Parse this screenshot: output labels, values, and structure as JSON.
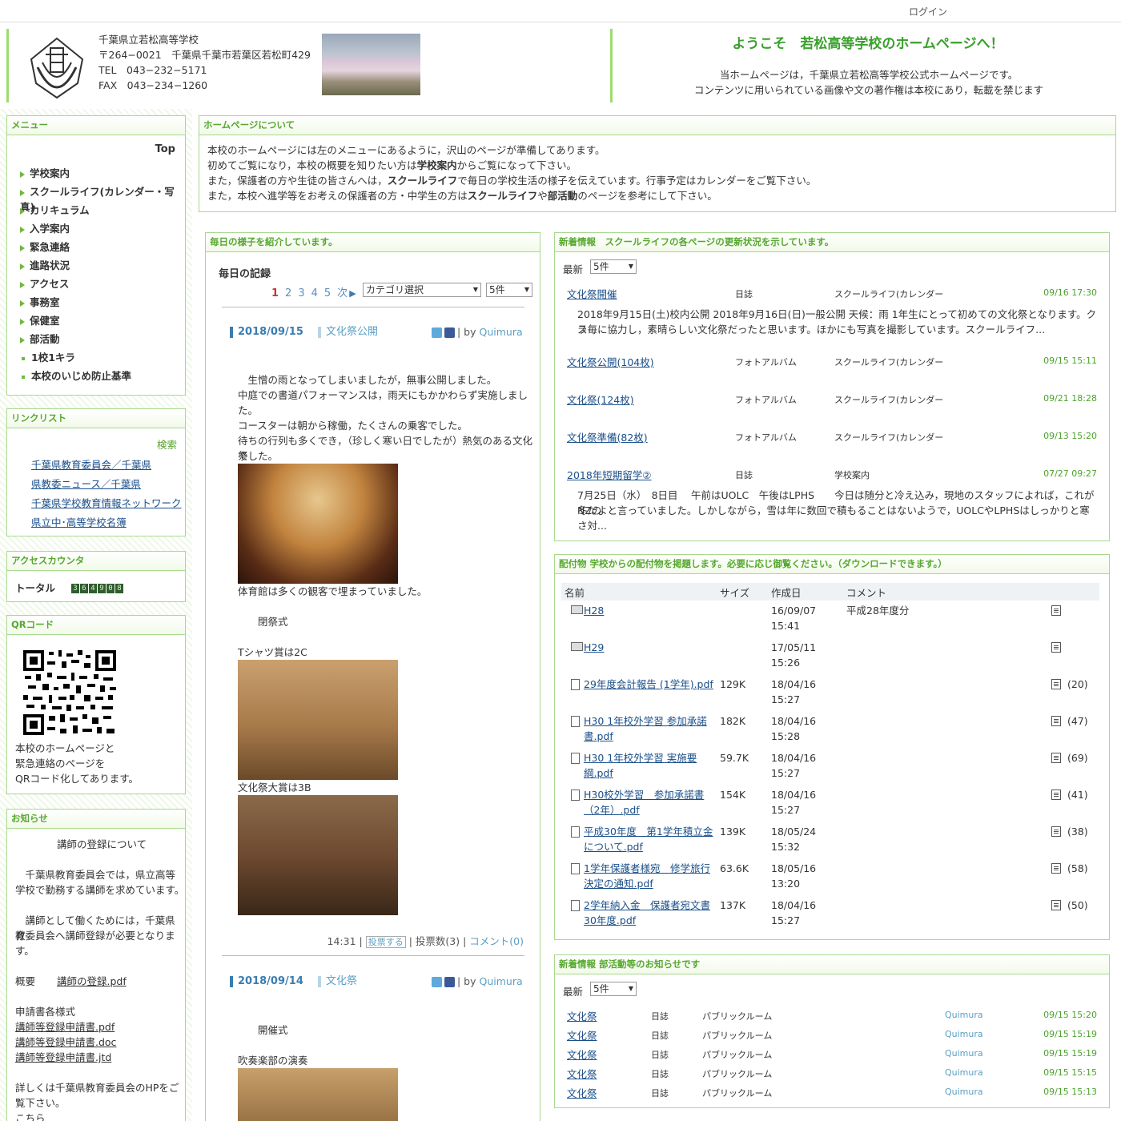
{
  "topbar": {
    "login": "ログイン"
  },
  "header": {
    "school_name": "千葉県立若松高等学校",
    "address": "〒264−0021　千葉県千葉市若葉区若松町429",
    "tel": "TEL　043−232−5171",
    "fax": "FAX　043−234−1260",
    "welcome": "ようこそ　若松高等学校のホームページへ！",
    "welcome_sub1": "当ホームページは，千葉県立若松高等学校公式ホームページです。",
    "welcome_sub2": "コンテンツに用いられている画像や文の著作権は本校にあり，転載を禁じます"
  },
  "menu": {
    "title": "メニュー",
    "top": "Top",
    "items": [
      "学校案内",
      "スクールライフ(カレンダー・写真)",
      "カリキュラム",
      "入学案内",
      "緊急連絡",
      "進路状況",
      "アクセス",
      "事務室",
      "保健室",
      "部活動"
    ],
    "dot_items": [
      "1校1キラ",
      "本校のいじめ防止基準"
    ]
  },
  "links": {
    "title": "リンクリスト",
    "search": "検索",
    "items": [
      "千葉県教育委員会／千葉県",
      "県教委ニュース／千葉県",
      "千葉県学校教育情報ネットワーク",
      "県立中･高等学校名簿"
    ]
  },
  "counter": {
    "title": "アクセスカウンタ",
    "label": "トータル",
    "digits": [
      "3",
      "6",
      "4",
      "9",
      "0",
      "8"
    ]
  },
  "qr": {
    "title": "QRコード",
    "lines": [
      "本校のホームページと",
      "緊急連絡のページを",
      "QRコード化してあります。"
    ]
  },
  "notice": {
    "title": "お知らせ",
    "heading": "講師の登録について",
    "p1a": "　千葉県教育委員会では，県立高等",
    "p1b": "学校で勤務する講師を求めています。",
    "p2a": "　講師として働くためには，千葉県教",
    "p2b": "育委員会へ講師登録が必要となりま",
    "p2c": "す。",
    "summary_label": "概要",
    "summary_link": "講師の登録.pdf",
    "forms_label": "申請書各様式",
    "forms": [
      "講師等登録申請書.pdf",
      "講師等登録申請書.doc",
      "講師等登録申請書.jtd"
    ],
    "detail1": "詳しくは千葉県教育委員会のHPをご",
    "detail2": "覧下さい。",
    "detail_link": "こちら"
  },
  "about": {
    "title": "ホームページについて",
    "l1": "本校のホームページには左のメニューにあるように，沢山のページが準備してあります。",
    "l2a": "初めてご覧になり，本校の概要を知りたい方は",
    "l2b": "学校案内",
    "l2c": "からご覧になって下さい。",
    "l3a": "また，保護者の方や生徒の皆さんへは，",
    "l3b": "スクールライフ",
    "l3c": "で毎日の学校生活の様子を伝えています。行事予定はカレンダーをご覧下さい。",
    "l4a": "また，本校へ進学等をお考えの保護者の方・中学生の方は",
    "l4b": "スクールライフ",
    "l4c": "や",
    "l4d": "部活動",
    "l4e": "のページを参考にして下さい。"
  },
  "diary": {
    "title": "毎日の様子を紹介しています。",
    "heading": "毎日の記録",
    "pages": [
      "1",
      "2",
      "3",
      "4",
      "5"
    ],
    "next": "次",
    "category": "カテゴリ選択",
    "count": "5件",
    "post1": {
      "date": "2018/09/15",
      "cat": "文化祭公開",
      "by": "| by",
      "author": "Quimura",
      "lines": [
        "　生憎の雨となってしまいましたが，無事公開しました。",
        "中庭での書道パフォーマンスは，雨天にもかかわらず実施しまし",
        "た。",
        "コースターは朝から稼働，たくさんの乗客でした。",
        "待ちの行列も多くでき，（珍しく寒い日でしたが）熱気のある文化祭",
        "でした。"
      ],
      "cap1": "体育館は多くの観客で埋まっていました。",
      "cap2": "　　閉祭式",
      "cap3": "Tシャツ賞は2C",
      "cap4": "文化祭大賞は3B",
      "time": "14:31 |",
      "vote": "投票する",
      "votes": "| 投票数(3) |",
      "comments": "コメント(0)"
    },
    "post2": {
      "date": "2018/09/14",
      "cat": "文化祭",
      "by": "| by",
      "author": "Quimura",
      "l1": "　　開催式",
      "l2": "吹奏楽部の演奏"
    }
  },
  "news": {
    "title": "新着情報　スクールライフの各ページの更新状況を示しています。",
    "latest": "最新",
    "count": "5件",
    "rows": [
      {
        "t": "文化祭開催",
        "type": "日誌",
        "area": "スクールライフ(カレンダー",
        "date": "09/16 17:30",
        "body": [
          "2018年9月15日(土)校内公開 2018年9月16日(日)一般公開 天候：雨 1年生にとって初めての文化祭となります。クラ",
          "ス毎に協力し，素晴らしい文化祭だったと思います。ほかにも写真を撮影しています。スクールライフ..."
        ]
      },
      {
        "t": "文化祭公開(104枚)",
        "type": "フォトアルバム",
        "area": "スクールライフ(カレンダー",
        "date": "09/15 15:11"
      },
      {
        "t": "文化祭(124枚)",
        "type": "フォトアルバム",
        "area": "スクールライフ(カレンダー",
        "date": "09/21 18:28"
      },
      {
        "t": "文化祭準備(82枚)",
        "type": "フォトアルバム",
        "area": "スクールライフ(カレンダー",
        "date": "09/13 15:20"
      },
      {
        "t": "2018年短期留学②",
        "type": "日誌",
        "area": "学校案内",
        "date": "07/27 09:27",
        "body": [
          "7月25日（水）　8日目　 午前はUOLC　午後はLPHS　　今日は随分と冷え込み，現地のスタッフによれば，これがNZの",
          "冬だよと言っていました。しかしながら，雪は年に数回で積もることはないようで，UOLCやLPHSはしっかりと寒さ対..."
        ]
      }
    ]
  },
  "files": {
    "title": "配付物 学校からの配付物を掲題します。必要に応じ御覧ください。（ダウンロードできます。）",
    "headers": {
      "name": "名前",
      "size": "サイズ",
      "date": "作成日",
      "comment": "コメント"
    },
    "rows": [
      {
        "n1": "H28",
        "n2": "",
        "size": "",
        "d1": "16/09/07",
        "d2": "15:41",
        "c": "平成28年度分",
        "dl": ""
      },
      {
        "n1": "H29",
        "n2": "",
        "size": "",
        "d1": "17/05/11",
        "d2": "15:26",
        "c": "",
        "dl": ""
      },
      {
        "n1": "29年度会計報告 (1学年).pdf",
        "n2": "",
        "size": "129K",
        "d1": "18/04/16",
        "d2": "15:27",
        "c": "",
        "dl": "(20)"
      },
      {
        "n1": "H30 1年校外学習 参加承諾",
        "n2": "書.pdf",
        "size": "182K",
        "d1": "18/04/16",
        "d2": "15:28",
        "c": "",
        "dl": "(47)"
      },
      {
        "n1": "H30 1年校外学習 実施要",
        "n2": "綱.pdf",
        "size": "59.7K",
        "d1": "18/04/16",
        "d2": "15:27",
        "c": "",
        "dl": "(69)"
      },
      {
        "n1": "H30校外学習　参加承諾書",
        "n2": "（2年）.pdf",
        "size": "154K",
        "d1": "18/04/16",
        "d2": "15:27",
        "c": "",
        "dl": "(41)"
      },
      {
        "n1": "平成30年度　第1学年積立金",
        "n2": "について.pdf",
        "size": "139K",
        "d1": "18/05/24",
        "d2": "15:32",
        "c": "",
        "dl": "(38)"
      },
      {
        "n1": "1学年保護者様宛　修学旅行",
        "n2": "決定の通知.pdf",
        "size": "63.6K",
        "d1": "18/05/16",
        "d2": "13:20",
        "c": "",
        "dl": "(58)"
      },
      {
        "n1": "2学年納入金　保護者宛文書",
        "n2": "30年度.pdf",
        "size": "137K",
        "d1": "18/04/16",
        "d2": "15:27",
        "c": "",
        "dl": "(50)"
      }
    ]
  },
  "clubs": {
    "title": "新着情報 部活動等のお知らせです",
    "latest": "最新",
    "count": "5件",
    "rows": [
      {
        "t": "文化祭",
        "type": "日誌",
        "room": "パブリックルーム",
        "user": "Quimura",
        "date": "09/15 15:20"
      },
      {
        "t": "文化祭",
        "type": "日誌",
        "room": "パブリックルーム",
        "user": "Quimura",
        "date": "09/15 15:19"
      },
      {
        "t": "文化祭",
        "type": "日誌",
        "room": "パブリックルーム",
        "user": "Quimura",
        "date": "09/15 15:19"
      },
      {
        "t": "文化祭",
        "type": "日誌",
        "room": "パブリックルーム",
        "user": "Quimura",
        "date": "09/15 15:15"
      },
      {
        "t": "文化祭",
        "type": "日誌",
        "room": "パブリックルーム",
        "user": "Quimura",
        "date": "09/15 15:13"
      }
    ]
  }
}
